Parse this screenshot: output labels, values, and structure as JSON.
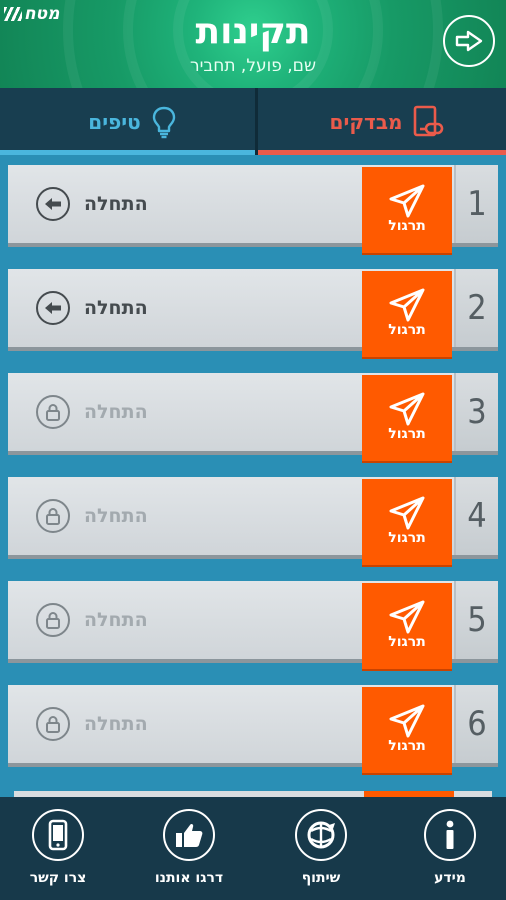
{
  "header": {
    "logo_text": "מטח",
    "title": "תקינות",
    "subtitle": "שם, פועל, תחביר",
    "back_icon": "arrow-right-circle-icon"
  },
  "tabs": [
    {
      "label": "מבדקים",
      "icon": "test-sheet-icon",
      "active": true,
      "color": "#ea5b4b"
    },
    {
      "label": "טיפים",
      "icon": "lightbulb-icon",
      "active": false,
      "color": "#4ab6dd"
    }
  ],
  "levels": [
    {
      "number": "1",
      "practice_label": "תרגול",
      "start_label": "התחלה",
      "locked": false
    },
    {
      "number": "2",
      "practice_label": "תרגול",
      "start_label": "התחלה",
      "locked": false
    },
    {
      "number": "3",
      "practice_label": "תרגול",
      "start_label": "התחלה",
      "locked": true
    },
    {
      "number": "4",
      "practice_label": "תרגול",
      "start_label": "התחלה",
      "locked": true
    },
    {
      "number": "5",
      "practice_label": "תרגול",
      "start_label": "התחלה",
      "locked": true
    },
    {
      "number": "6",
      "practice_label": "תרגול",
      "start_label": "התחלה",
      "locked": true
    }
  ],
  "footer": [
    {
      "label": "מידע",
      "icon": "info-icon"
    },
    {
      "label": "שיתוף",
      "icon": "share-icon"
    },
    {
      "label": "דרגו אותנו",
      "icon": "thumbs-up-icon"
    },
    {
      "label": "צרו קשר",
      "icon": "phone-icon"
    }
  ],
  "colors": {
    "header_green": "#1fb37a",
    "background_blue": "#2a8fb5",
    "tab_bar": "#183e50",
    "practice_orange": "#ff5a00",
    "footer": "#17394a"
  }
}
